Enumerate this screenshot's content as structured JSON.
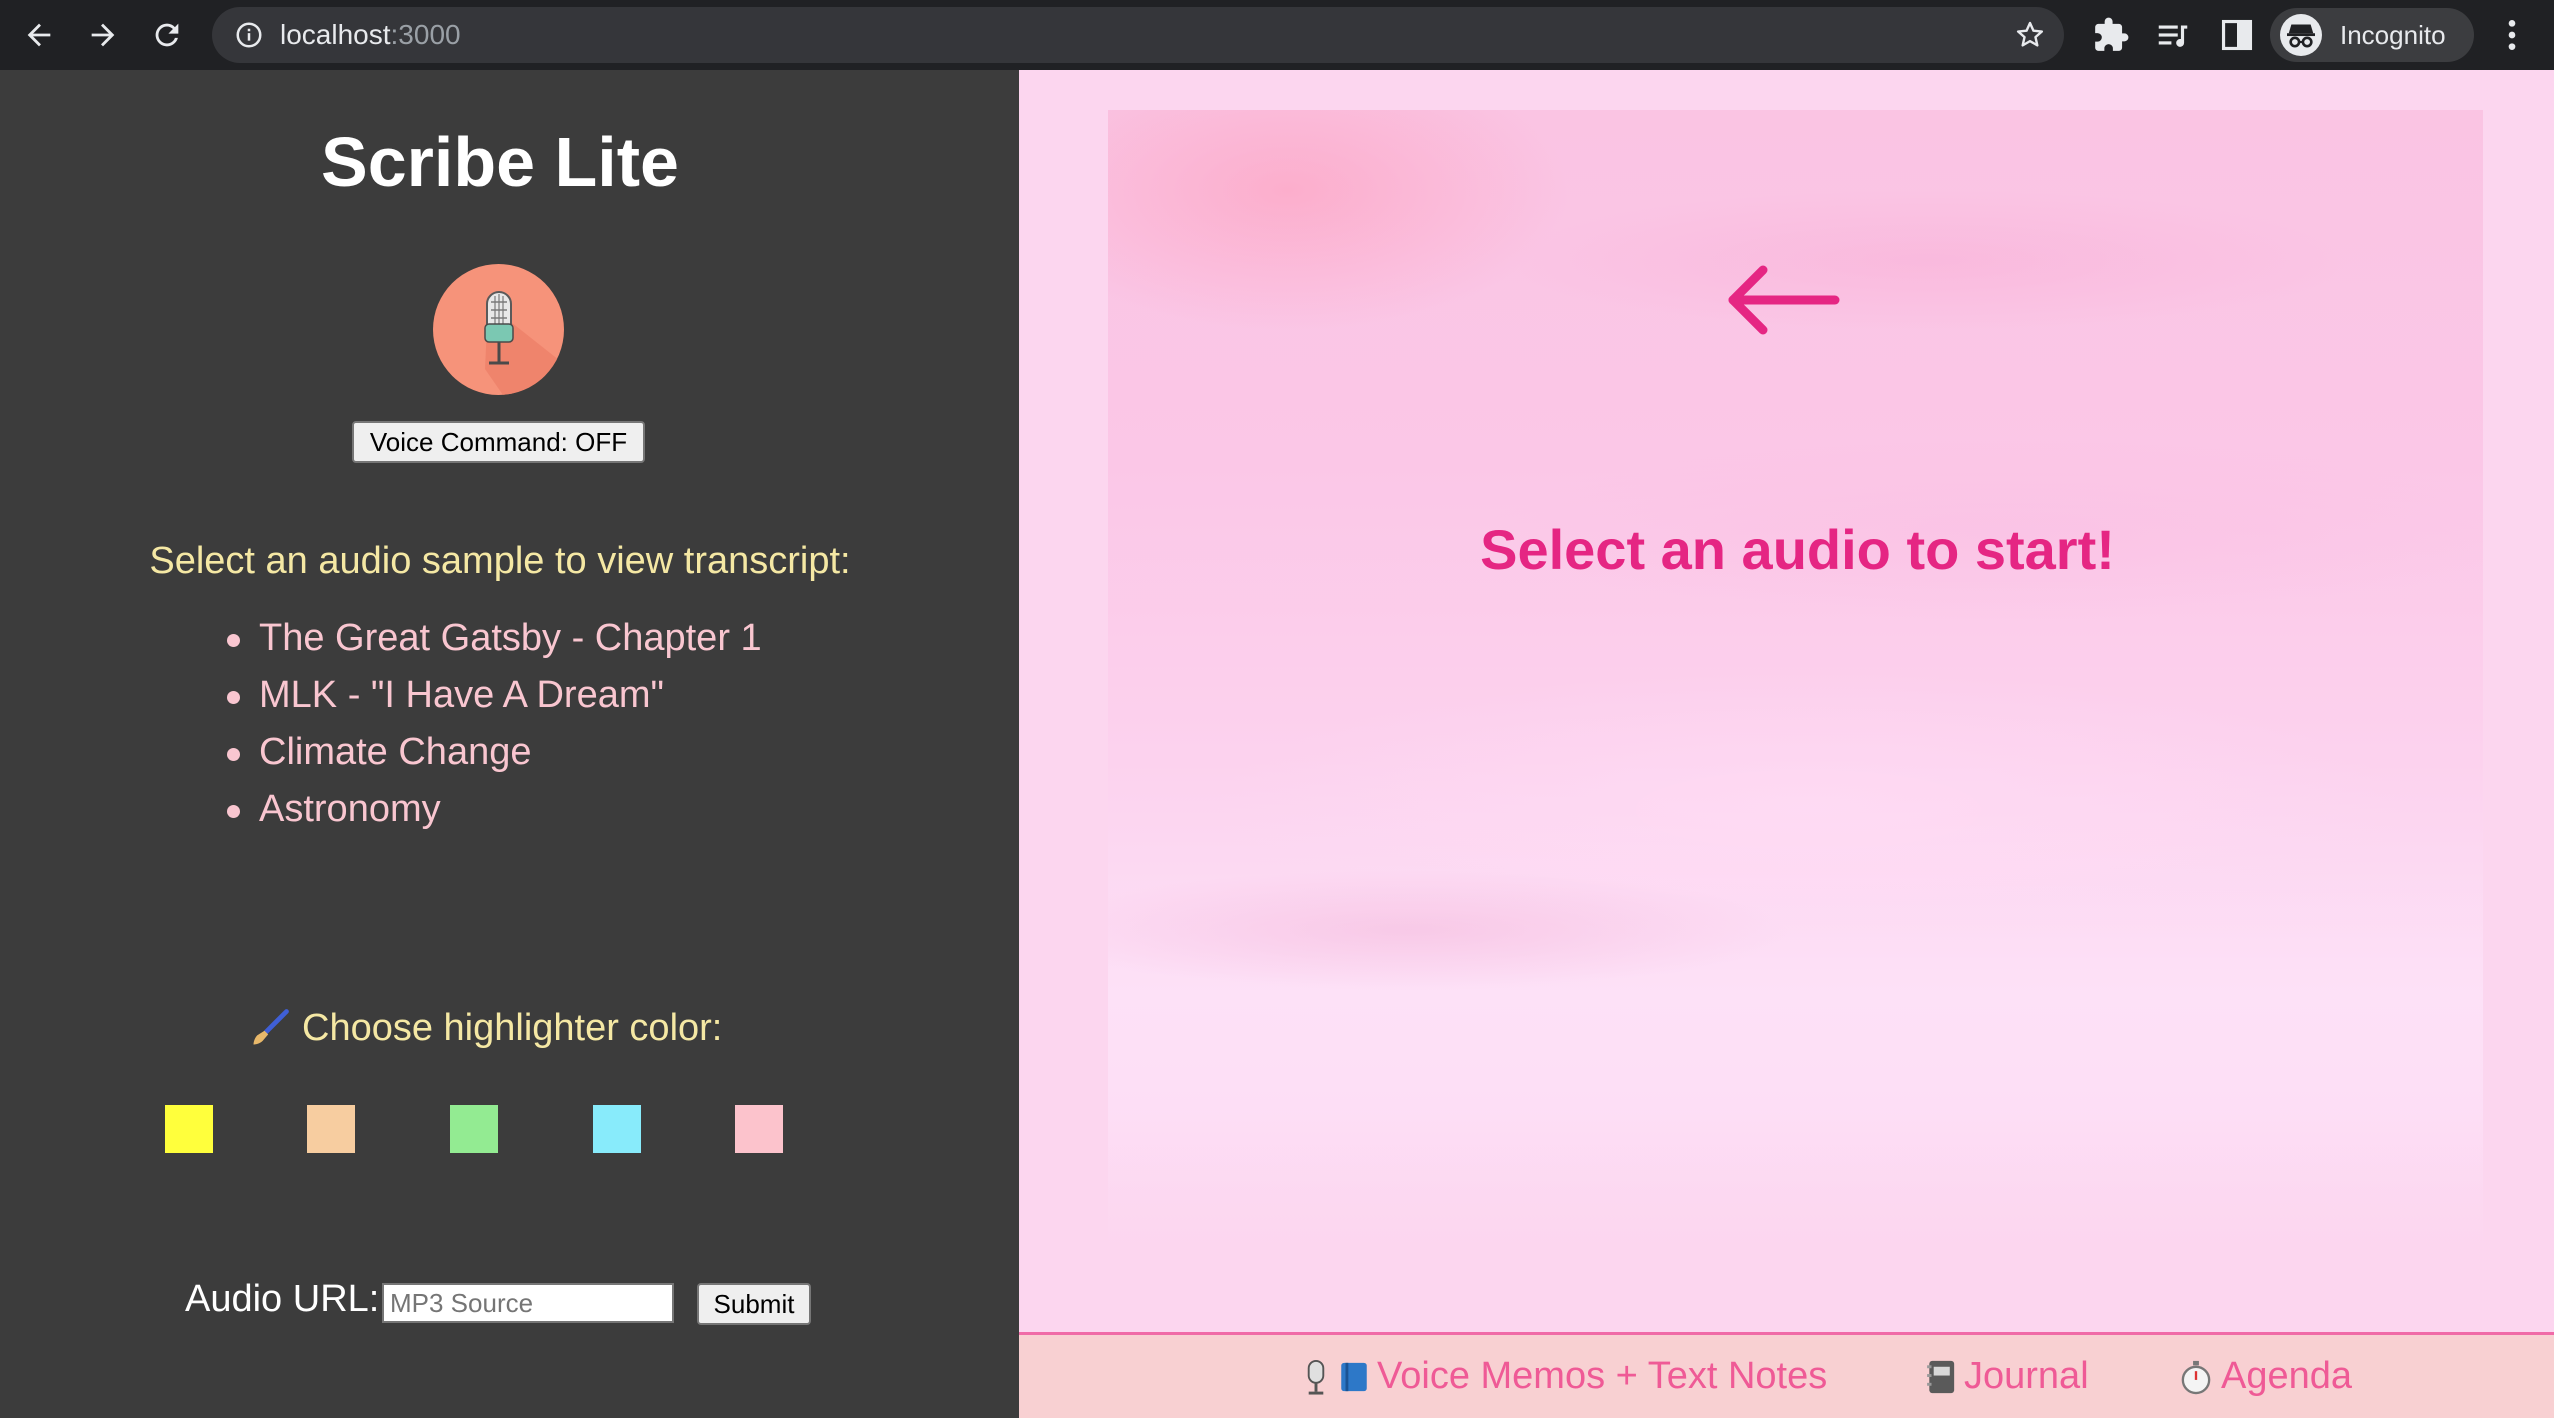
{
  "browser": {
    "url_host": "localhost",
    "url_port": ":3000",
    "profile_label": "Incognito",
    "icons": [
      "back-icon",
      "forward-icon",
      "reload-icon",
      "info-icon",
      "star-icon",
      "extensions-icon",
      "reading-list-icon",
      "side-panel-icon",
      "incognito-icon",
      "menu-icon"
    ]
  },
  "sidebar": {
    "title": "Scribe Lite",
    "voice_command_label": "Voice Command: OFF",
    "samples_heading": "Select an audio sample to view transcript:",
    "samples": [
      {
        "label": "The Great Gatsby - Chapter 1"
      },
      {
        "label": "MLK - \"I Have A Dream\""
      },
      {
        "label": "Climate Change"
      },
      {
        "label": "Astronomy"
      }
    ],
    "highlighter_heading": "Choose highlighter color:",
    "highlighter_colors": [
      "#ffff3c",
      "#f7cda0",
      "#93eb92",
      "#88ebfb",
      "#fcc3cc"
    ],
    "audio_url_label": "Audio URL:",
    "audio_url_placeholder": "MP3 Source",
    "audio_url_value": "",
    "submit_label": "Submit"
  },
  "main": {
    "prompt": "Select an audio to start!"
  },
  "footer_nav": {
    "items": [
      {
        "label": "Voice Memos + Text Notes",
        "icons": [
          "microphone-icon",
          "book-icon"
        ]
      },
      {
        "label": "Journal",
        "icons": [
          "notebook-icon"
        ]
      },
      {
        "label": "Agenda",
        "icons": [
          "stopwatch-icon"
        ]
      }
    ]
  },
  "colors": {
    "sidebar_bg": "#3c3c3c",
    "heading_yellow": "#f5e8a4",
    "sample_pink": "#f9c6d0",
    "accent_pink": "#e52683",
    "footer_link": "#ef5a96",
    "mic_circle": "#f6937a"
  }
}
